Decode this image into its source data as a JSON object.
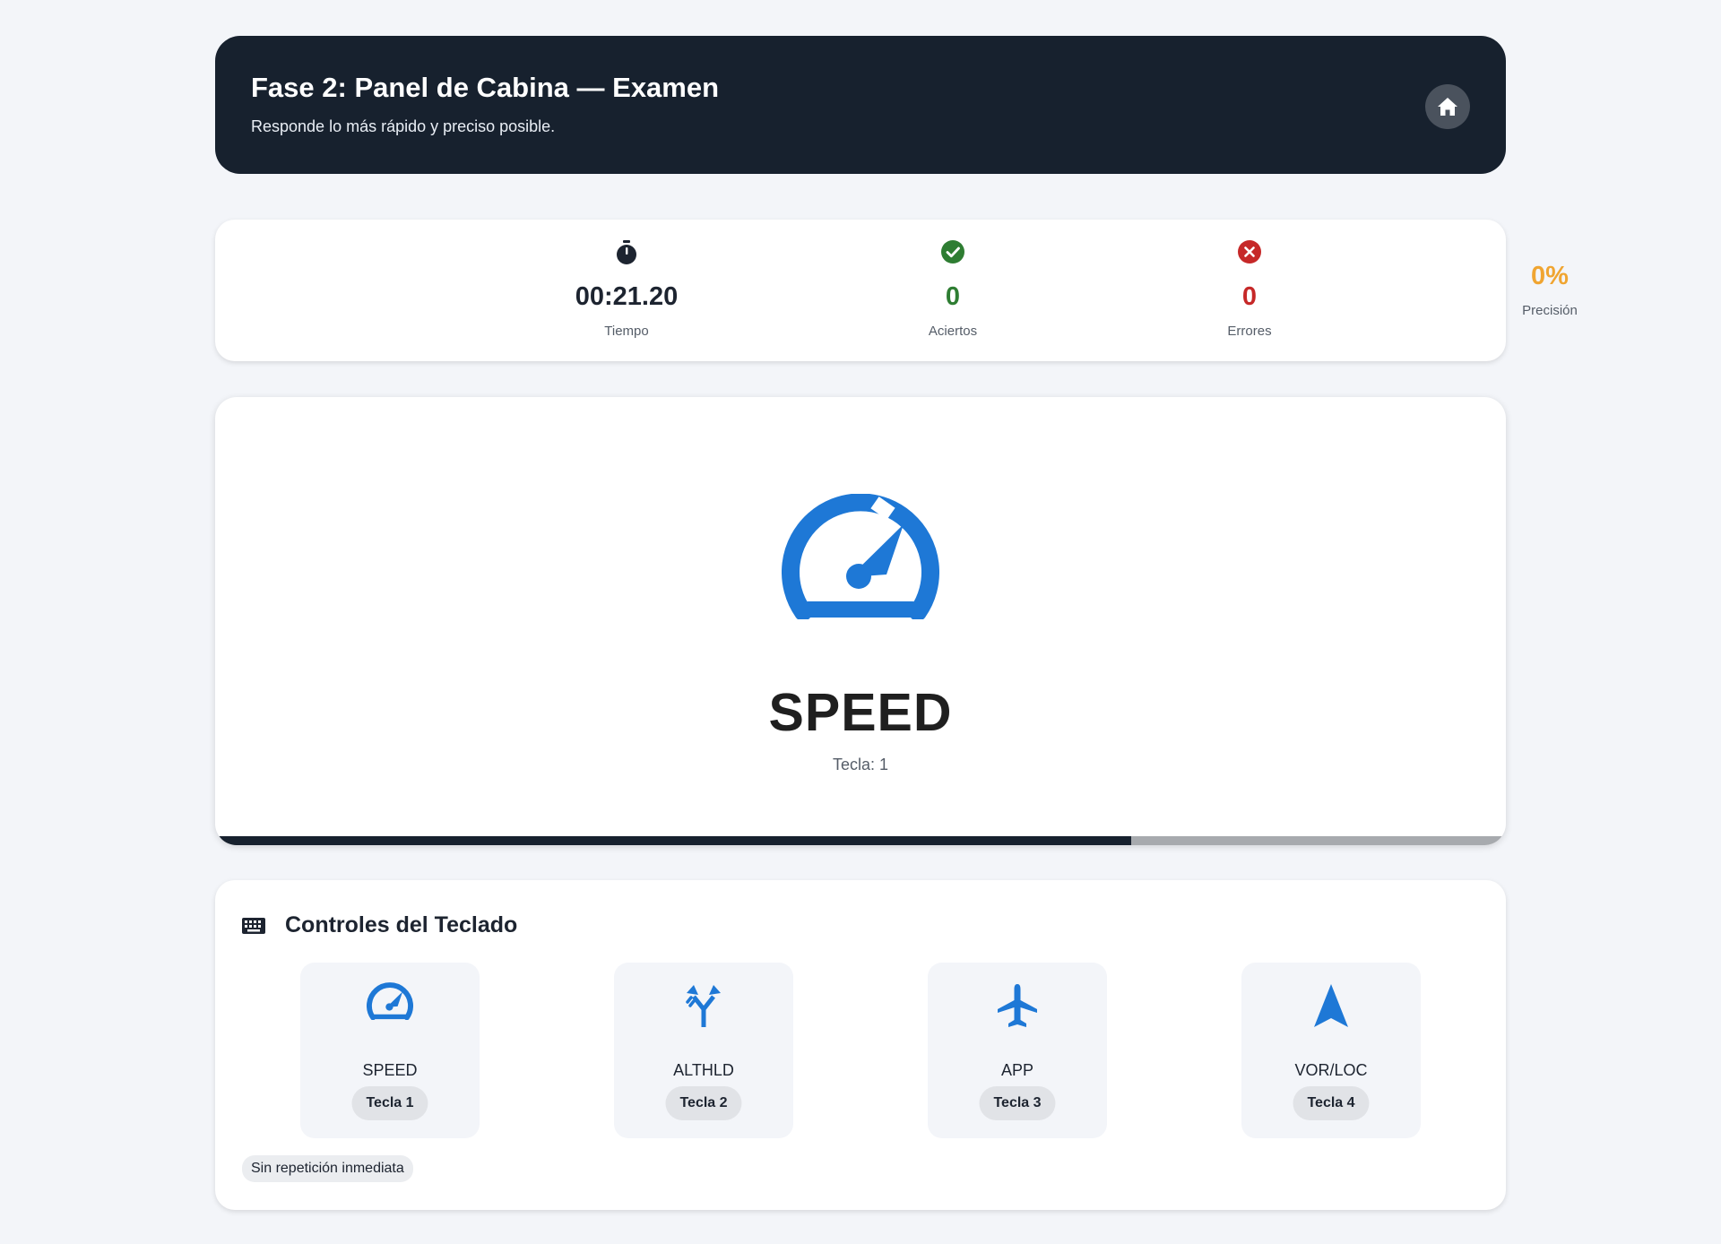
{
  "header": {
    "title": "Fase 2: Panel de Cabina — Examen",
    "subtitle": "Responde lo más rápido y preciso posible.",
    "home_icon": "home-icon"
  },
  "stats": {
    "time": {
      "value": "00:21.20",
      "label": "Tiempo",
      "icon": "stopwatch-icon"
    },
    "correct": {
      "value": "0",
      "label": "Aciertos",
      "icon": "check-circle-icon",
      "color": "#2e7d32"
    },
    "errors": {
      "value": "0",
      "label": "Errores",
      "icon": "x-circle-icon",
      "color": "#c62828"
    },
    "precision": {
      "value": "0%",
      "label": "Precisión",
      "color": "#f0a531"
    }
  },
  "current": {
    "command": "SPEED",
    "key_text": "Tecla: 1",
    "icon": "speedometer-icon",
    "progress": 0.71
  },
  "controls": {
    "title": "Controles del Teclado",
    "title_icon": "keyboard-icon",
    "keys": [
      {
        "name": "SPEED",
        "badge": "Tecla 1",
        "icon": "speedometer-icon"
      },
      {
        "name": "ALTHLD",
        "badge": "Tecla 2",
        "icon": "merge-arrows-icon"
      },
      {
        "name": "APP",
        "badge": "Tecla 3",
        "icon": "airplane-icon"
      },
      {
        "name": "VOR/LOC",
        "badge": "Tecla 4",
        "icon": "navigation-arrow-icon"
      }
    ],
    "note": "Sin repetición inmediata"
  },
  "colors": {
    "accent_blue": "#1e78d6",
    "dark": "#17212e",
    "background": "#f3f5f9"
  }
}
